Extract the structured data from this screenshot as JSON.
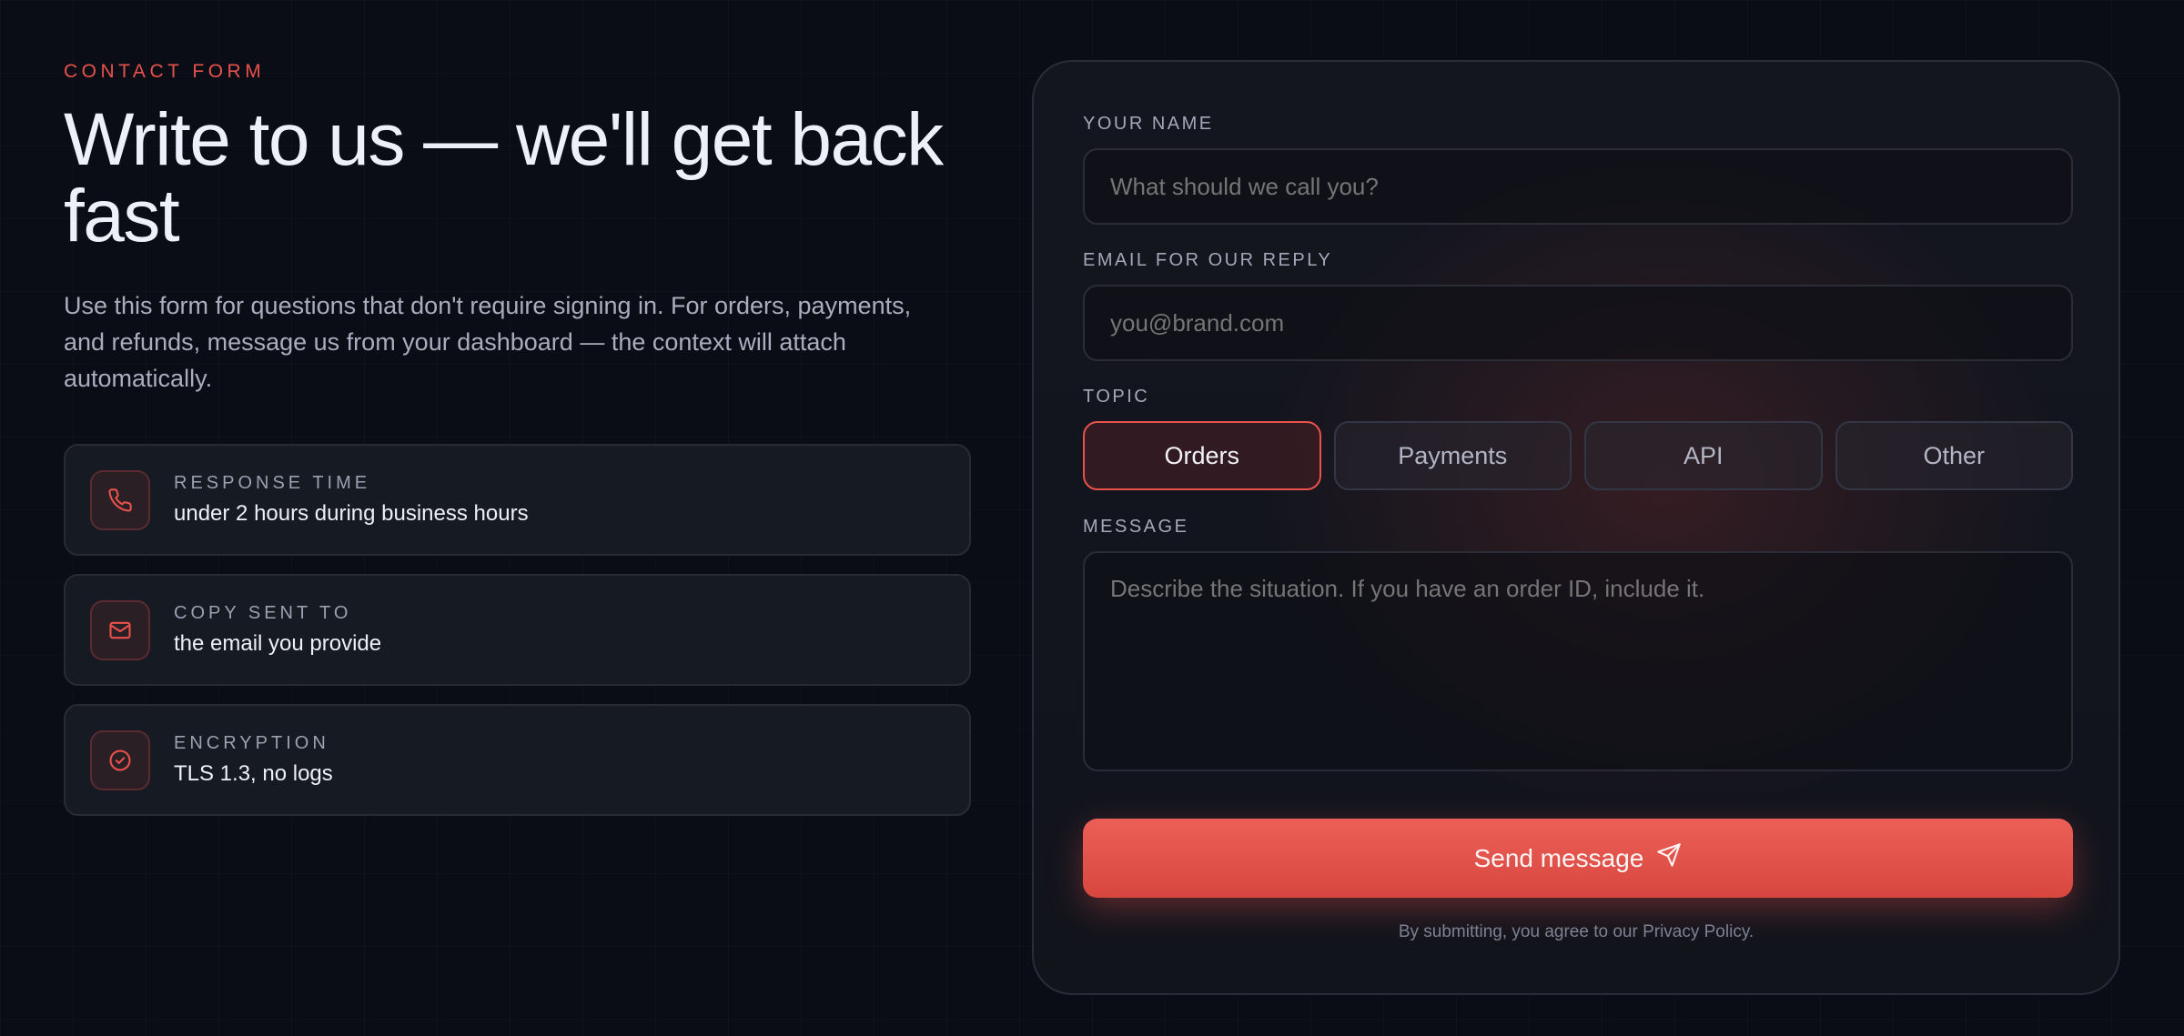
{
  "left": {
    "eyebrow": "CONTACT FORM",
    "headline": "Write to us — we'll get back fast",
    "lede": "Use this form for questions that don't require signing in. For orders, payments, and refunds, message us from your dashboard — the context will attach automatically."
  },
  "cards": [
    {
      "icon": "phone-icon",
      "label": "RESPONSE TIME",
      "value": "under 2 hours during business hours"
    },
    {
      "icon": "mail-icon",
      "label": "COPY SENT TO",
      "value": "the email you provide"
    },
    {
      "icon": "check-circle-icon",
      "label": "ENCRYPTION",
      "value": "TLS 1.3, no logs"
    }
  ],
  "form": {
    "name_label": "YOUR NAME",
    "name_placeholder": "What should we call you?",
    "name_value": "",
    "email_label": "EMAIL FOR OUR REPLY",
    "email_placeholder": "you@brand.com",
    "email_value": "",
    "topic_label": "TOPIC",
    "topics": [
      "Orders",
      "Payments",
      "API",
      "Other"
    ],
    "selected_topic": "Orders",
    "message_label": "MESSAGE",
    "message_placeholder": "Describe the situation. If you have an order ID, include it.",
    "message_value": "",
    "send_label": "Send message",
    "send_icon": "send-icon",
    "legal": "By submitting, you agree to our Privacy Policy."
  },
  "colors": {
    "accent": "#e8524b",
    "background": "#0b0d16",
    "panel": "#14161f"
  }
}
